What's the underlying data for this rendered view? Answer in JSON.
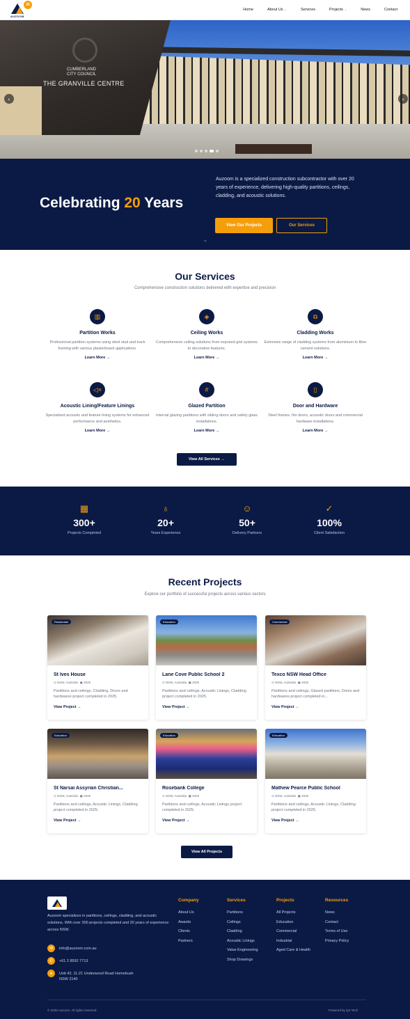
{
  "nav": {
    "logo_text": "AUZOOM",
    "logo_badge": "20",
    "items": [
      {
        "label": "Home",
        "caret": false
      },
      {
        "label": "About Us",
        "caret": true
      },
      {
        "label": "Services",
        "caret": false
      },
      {
        "label": "Projects",
        "caret": true
      },
      {
        "label": "News",
        "caret": false
      },
      {
        "label": "Contact",
        "caret": false
      }
    ]
  },
  "hero": {
    "sign_line1": "CUMBERLAND",
    "sign_line2": "CITY COUNCIL",
    "sign_main": "THE GRANVILLE CENTRE",
    "slides": 5,
    "active_slide": 4
  },
  "banner": {
    "title_pre": "Celebrating ",
    "title_highlight": "20",
    "title_post": " Years",
    "text": "Auzoom is a specialized construction subcontractor with over 20 years of experience, delivering high-quality partitions, ceilings, cladding, and acoustic solutions.",
    "btn_primary": "View Our Projects",
    "btn_secondary": "Our Services"
  },
  "services": {
    "title": "Our Services",
    "subtitle": "Comprehensive construction solutions delivered with expertise and precision",
    "items": [
      {
        "icon": "▥",
        "title": "Partition Works",
        "desc": "Professional partition systems using steel stud and track framing with various plasterboard applications.",
        "link": "Learn More →"
      },
      {
        "icon": "◈",
        "title": "Ceiling Works",
        "desc": "Comprehensive ceiling solutions from exposed grid systems to decorative features.",
        "link": "Learn More →"
      },
      {
        "icon": "⧉",
        "title": "Cladding Works",
        "desc": "Extensive range of cladding systems from aluminium to fibre cement solutions.",
        "link": "Learn More →"
      },
      {
        "icon": "◁×",
        "title": "Acoustic Lining/Feature Linings",
        "desc": "Specialized acoustic and feature lining systems for enhanced performance and aesthetics.",
        "link": "Learn More →"
      },
      {
        "icon": "#",
        "title": "Glazed Partition",
        "desc": "Internal glazing partitions with sliding doors and safety glass installations.",
        "link": "Learn More →"
      },
      {
        "icon": "▯",
        "title": "Door and Hardware",
        "desc": "Steel frames, fire doors, acoustic doors and commercial hardware installations.",
        "link": "Learn More →"
      }
    ],
    "button": "View All Services  →"
  },
  "stats": [
    {
      "icon": "▦",
      "value": "300+",
      "label": "Projects Completed"
    },
    {
      "icon": "♁",
      "value": "20+",
      "label": "Years Experience"
    },
    {
      "icon": "☺",
      "value": "50+",
      "label": "Delivery Partners"
    },
    {
      "icon": "✓",
      "value": "100%",
      "label": "Client Satisfaction"
    }
  ],
  "projects": {
    "title": "Recent Projects",
    "subtitle": "Explore our portfolio of successful projects across various sectors",
    "items": [
      {
        "tag": "Residential",
        "title": "St Ives House",
        "location": "NSW, Australia",
        "year": "2025",
        "desc": "Partitions and ceilings, Cladding, Doors and hardwares project completed in 2025.",
        "link": "View Project  →"
      },
      {
        "tag": "Education",
        "title": "Lane Cove Public School 2",
        "location": "NSW, Australia",
        "year": "2025",
        "desc": "Partitions and ceilings, Acoustic Linings, Cladding project completed in 2025.",
        "link": "View Project  →"
      },
      {
        "tag": "Commercial",
        "title": "Texco NSW Head Office",
        "location": "NSW, Australia",
        "year": "2025",
        "desc": "Partitions and ceilings, Glazed partitions, Doors and hardwares project completed in...",
        "link": "View Project  →"
      },
      {
        "tag": "Education",
        "title": "St Narsai Assyrian Christian...",
        "location": "NSW, Australia",
        "year": "2025",
        "desc": "Partitions and ceilings, Acoustic Linings, Cladding project completed in 2025.",
        "link": "View Project  →"
      },
      {
        "tag": "Education",
        "title": "Rosebank College",
        "location": "NSW, Australia",
        "year": "2025",
        "desc": "Partitions and ceilings, Acoustic Linings project completed in 2025.",
        "link": "View Project  →"
      },
      {
        "tag": "Education",
        "title": "Mathew Pearce Public School",
        "location": "NSW, Australia",
        "year": "2025",
        "desc": "Partitions and ceilings, Acoustic Linings, Cladding project completed in 2025.",
        "link": "View Project  →"
      }
    ],
    "button": "View All Projects"
  },
  "footer": {
    "about": "Auzoom specializes in partitions, ceilings, cladding, and acoustic solutions. With over 300 projects completed and 20 years of experience across NSW.",
    "email": "info@auzoom.com.au",
    "phone": "+61 2 8592 7713",
    "address": "Unit 42, 11-21 Underwood Road Homebush NSW 2140",
    "columns": [
      {
        "title": "Company",
        "links": [
          "About Us",
          "Awards",
          "Clients",
          "Partners"
        ]
      },
      {
        "title": "Services",
        "links": [
          "Partitions",
          "Ceilings",
          "Cladding",
          "Acoustic Linings",
          "Value Engineering",
          "Shop Drawings"
        ]
      },
      {
        "title": "Projects",
        "links": [
          "All Projects",
          "Education",
          "Commercial",
          "Industrial",
          "Aged Care & Health"
        ]
      },
      {
        "title": "Resources",
        "links": [
          "News",
          "Contact",
          "Terms of Use",
          "Privacy Policy"
        ]
      }
    ],
    "copyright": "© 2025 Auzoom. All rights reserved.",
    "powered": "Powered by  QX Tech"
  }
}
